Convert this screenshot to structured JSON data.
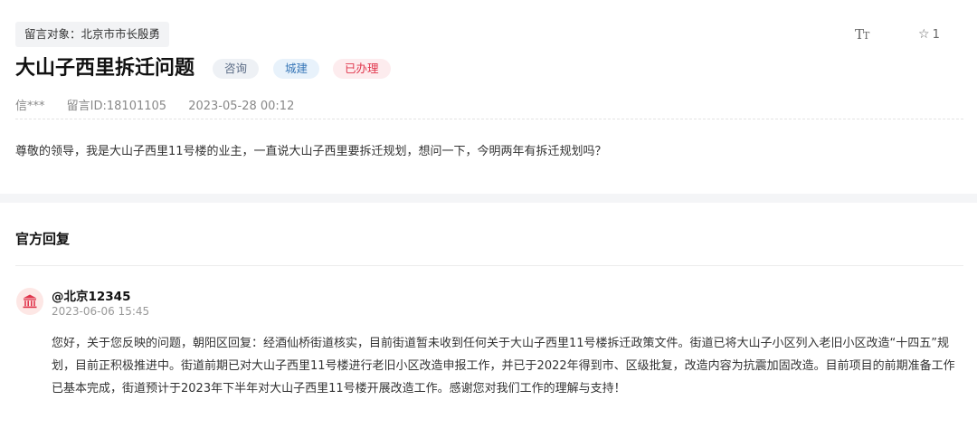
{
  "recipient": "留言对象：北京市市长殷勇",
  "toolbar": {
    "font_size_icon": "font-size-icon",
    "font_size_big": "T",
    "font_size_small": "T",
    "favorite_icon": "star-outline-icon",
    "favorite_count": "1"
  },
  "message": {
    "title": "大山子西里拆迁问题",
    "tags": {
      "type": "咨询",
      "category": "城建",
      "status": "已办理"
    },
    "author": "信***",
    "message_id": "留言ID:18101105",
    "datetime": "2023-05-28 00:12",
    "content": "尊敬的领导，我是大山子西里11号楼的业主，一直说大山子西里要拆迁规划，想问一下，今明两年有拆迁规划吗？"
  },
  "reply": {
    "section_title": "官方回复",
    "avatar_icon": "government-building-icon",
    "replier": "@北京12345",
    "datetime": "2023-06-06 15:45",
    "content": "您好，关于您反映的问题，朝阳区回复：经酒仙桥街道核实，目前街道暂未收到任何关于大山子西里11号楼拆迁政策文件。街道已将大山子小区列入老旧小区改造“十四五”规划，目前正积极推进中。街道前期已对大山子西里11号楼进行老旧小区改造申报工作，并已于2022年得到市、区级批复，改造内容为抗震加固改造。目前项目的前期准备工作已基本完成，街道预计于2023年下半年对大山子西里11号楼开展改造工作。感谢您对我们工作的理解与支持！"
  },
  "colors": {
    "status_red": "#e0364c",
    "category_blue": "#3a78b8",
    "avatar_bg": "#fde7e5",
    "avatar_fg": "#e0364c"
  }
}
